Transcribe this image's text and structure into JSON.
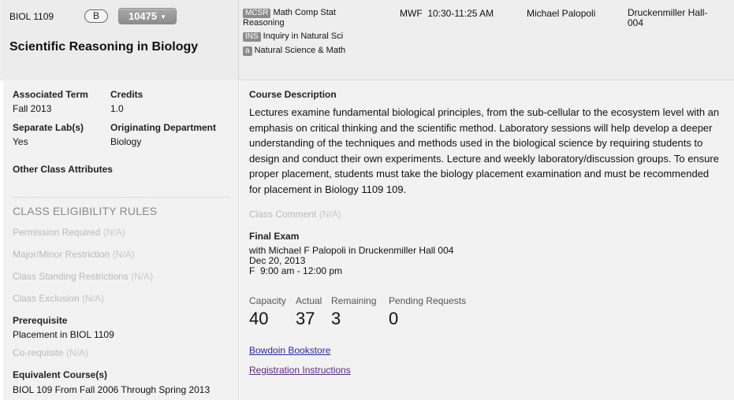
{
  "course": {
    "code": "BIOL 1109",
    "section": "B",
    "crn": "10475",
    "title": "Scientific Reasoning in Biology"
  },
  "attributes": [
    {
      "tag": "MCSR",
      "label": "Math Comp Stat Reasoning"
    },
    {
      "tag": "INS",
      "label": "Inquiry in Natural Sci"
    },
    {
      "tag": "a",
      "label": "Natural Science & Math"
    }
  ],
  "meeting": {
    "days_time": "MWF  10:30-11:25 AM",
    "instructor": "Michael Palopoli",
    "location": "Druckenmiller Hall-004"
  },
  "details": {
    "associated_term_label": "Associated Term",
    "associated_term_value": "Fall 2013",
    "credits_label": "Credits",
    "credits_value": "1.0",
    "separate_labs_label": "Separate Lab(s)",
    "separate_labs_value": "Yes",
    "orig_dept_label": "Originating Department",
    "orig_dept_value": "Biology",
    "other_attrs_label": "Other Class Attributes"
  },
  "eligibility": {
    "title": "CLASS ELIGIBILITY RULES",
    "na": "(N/A)",
    "permission": "Permission Required",
    "major_minor": "Major/Minor Restriction",
    "standing": "Class Standing Restrictions",
    "exclusion": "Class Exclusion",
    "prereq_label": "Prerequisite",
    "prereq_value": "Placement in BIOL 1109",
    "coreq": "Co-requisite",
    "equiv_label": "Equivalent Course(s)",
    "equiv_value": "BIOL 109 From Fall 2006 Through Spring 2013"
  },
  "description": {
    "label": "Course Description",
    "text": "Lectures examine fundamental biological principles, from the sub-cellular to the ecosystem level with an emphasis on critical thinking and the scientific method. Laboratory sessions will help develop a deeper understanding of the techniques and methods used in the biological science by requiring students to design and conduct their own experiments. Lecture and weekly laboratory/discussion groups. To ensure proper placement, students must take the biology placement examination and must be recommended for placement in Biology 1109 109."
  },
  "class_comment": {
    "label": "Class Comment",
    "na": "(N/A)"
  },
  "final_exam": {
    "label": "Final Exam",
    "line1": "with Michael F Palopoli in Druckenmiller Hall 004",
    "line2": "Dec 20, 2013",
    "line3": "F  9:00 am - 12:00 pm"
  },
  "enrollment": {
    "capacity_label": "Capacity",
    "capacity": "40",
    "actual_label": "Actual",
    "actual": "37",
    "remaining_label": "Remaining",
    "remaining": "3",
    "pending_label": "Pending Requests",
    "pending": "0"
  },
  "links": {
    "bookstore": "Bowdoin Bookstore",
    "registration": "Registration Instructions"
  }
}
